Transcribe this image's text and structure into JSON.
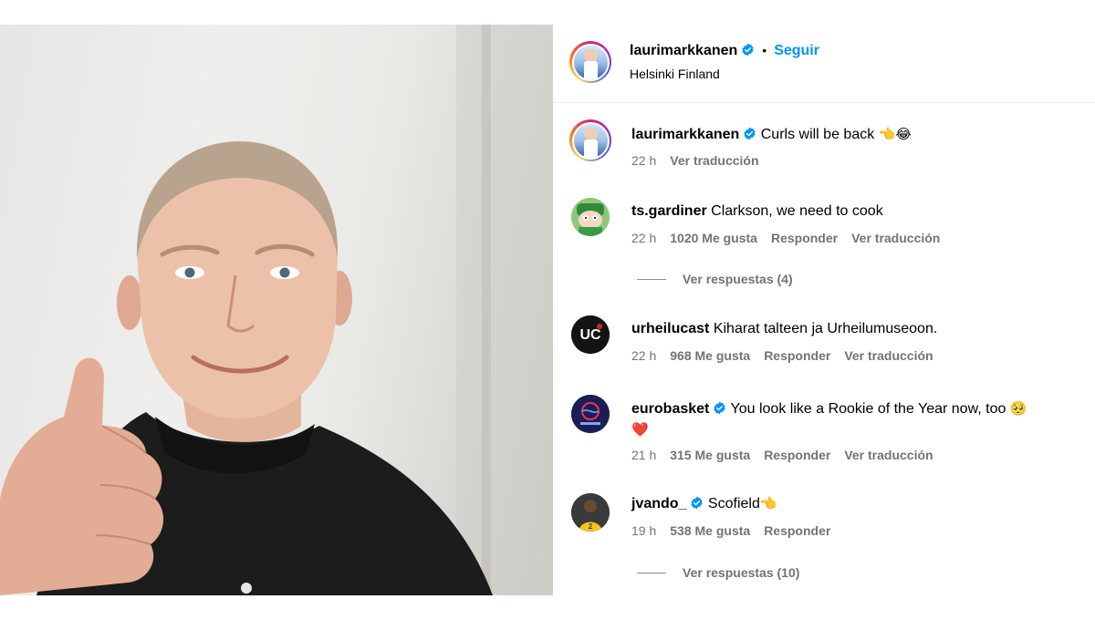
{
  "post": {
    "username": "laurimarkkanen",
    "follow_label": "Seguir",
    "separator": "•",
    "location": "Helsinki Finland"
  },
  "caption": {
    "username": "laurimarkkanen",
    "text": "Curls will be back",
    "emoji": "👈😂",
    "time": "22 h",
    "translate_label": "Ver traducción"
  },
  "comments": [
    {
      "username": "ts.gardiner",
      "verified": false,
      "text": "Clarkson, we need to cook",
      "time": "22 h",
      "likes": "1020 Me gusta",
      "reply_label": "Responder",
      "translate_label": "Ver traducción",
      "view_replies": "Ver respuestas (4)"
    },
    {
      "username": "urheilucast",
      "verified": false,
      "text": "Kiharat talteen ja Urheilumuseoon.",
      "time": "22 h",
      "likes": "968 Me gusta",
      "reply_label": "Responder",
      "translate_label": "Ver traducción"
    },
    {
      "username": "eurobasket",
      "verified": true,
      "text": "You look like a Rookie of the Year now, too",
      "emoji": "🥺",
      "emoji2": "❤️",
      "time": "21 h",
      "likes": "315 Me gusta",
      "reply_label": "Responder",
      "translate_label": "Ver traducción"
    },
    {
      "username": "jvando_",
      "verified": true,
      "text": "Scofield",
      "emoji": "👈",
      "time": "19 h",
      "likes": "538 Me gusta",
      "reply_label": "Responder",
      "view_replies": "Ver respuestas (10)"
    }
  ],
  "colors": {
    "link_blue": "#0095f6",
    "verified_blue": "#0095f6",
    "secondary_text": "#737373"
  },
  "icons": {
    "verified": "verified-badge-icon"
  }
}
